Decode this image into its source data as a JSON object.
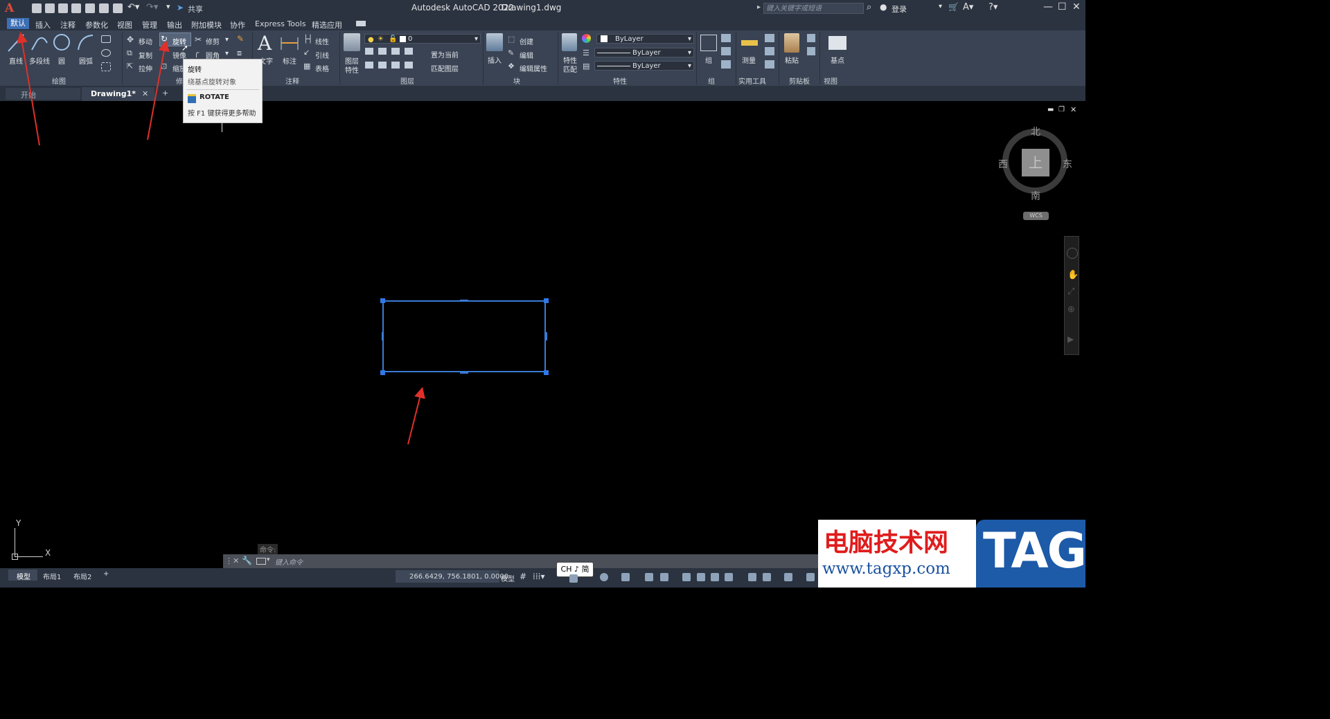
{
  "app": {
    "title": "Autodesk AutoCAD 2022",
    "document": "Drawing1.dwg",
    "logo": "A",
    "share": "共享",
    "search_placeholder": "键入关键字或短语",
    "login": "登录"
  },
  "menu_tabs": [
    {
      "label": "默认",
      "active": true
    },
    {
      "label": "插入"
    },
    {
      "label": "注释"
    },
    {
      "label": "参数化"
    },
    {
      "label": "视图"
    },
    {
      "label": "管理"
    },
    {
      "label": "输出"
    },
    {
      "label": "附加模块"
    },
    {
      "label": "协作"
    },
    {
      "label": "Express Tools"
    },
    {
      "label": "精选应用"
    }
  ],
  "ribbon": {
    "draw": {
      "line": "直线",
      "polyline": "多段线",
      "circle": "圆",
      "arc": "圆弧",
      "panel": "绘图"
    },
    "modify": {
      "move": "移动",
      "rotate": "旋转",
      "trim": "修剪",
      "copy": "复制",
      "mirror": "镜像",
      "fillet": "圆角",
      "stretch": "拉伸",
      "scale": "缩放",
      "panel": "修"
    },
    "annotation": {
      "text": "文字",
      "dimension": "标注",
      "linear": "线性",
      "leader": "引线",
      "table": "表格",
      "panel": "注释"
    },
    "layers": {
      "properties": "图层\n特性",
      "properties_line1": "图层",
      "properties_line2": "特性",
      "layer_value": "0",
      "set_current": "置为当前",
      "match_layer": "匹配图层",
      "panel": "图层"
    },
    "block": {
      "insert": "插入",
      "create": "创建",
      "edit": "编辑",
      "edit_attr": "编辑属性",
      "panel": "块"
    },
    "properties": {
      "match_line1": "特性",
      "match_line2": "匹配",
      "color": "ByLayer",
      "linetype": "ByLayer",
      "lineweight": "ByLayer",
      "panel": "特性"
    },
    "groups": {
      "group": "组",
      "panel": "组"
    },
    "utilities": {
      "measure": "测量",
      "panel": "实用工具"
    },
    "clipboard": {
      "paste": "粘贴",
      "panel": "剪贴板"
    },
    "view": {
      "base": "基点",
      "panel": "视图"
    }
  },
  "tooltip": {
    "title": "旋转",
    "desc": "绕基点旋转对象",
    "command": "ROTATE",
    "help": "按 F1 键获得更多帮助"
  },
  "doc_tabs": [
    {
      "label": "开始"
    },
    {
      "label": "Drawing1*",
      "active": true
    }
  ],
  "compass": {
    "north": "北",
    "south": "南",
    "east": "东",
    "west": "西",
    "top": "上",
    "wcs": "WCS"
  },
  "ucs": {
    "x": "X",
    "y": "Y"
  },
  "command": {
    "history": "命令:",
    "placeholder": "键入命令"
  },
  "status": {
    "model_tab": "模型",
    "layout1": "布局1",
    "layout2": "布局2",
    "coords": "266.6429, 756.1801, 0.0000",
    "mode": "模型",
    "ime": "CH ♪ 简"
  },
  "watermark": {
    "cn": "电脑技术网",
    "url": "www.tagxp.com",
    "tag": "TAG"
  },
  "colors": {
    "accent": "#3d6fb5",
    "selection": "#3a7bd5",
    "annotation_arrow": "#e0302a"
  }
}
